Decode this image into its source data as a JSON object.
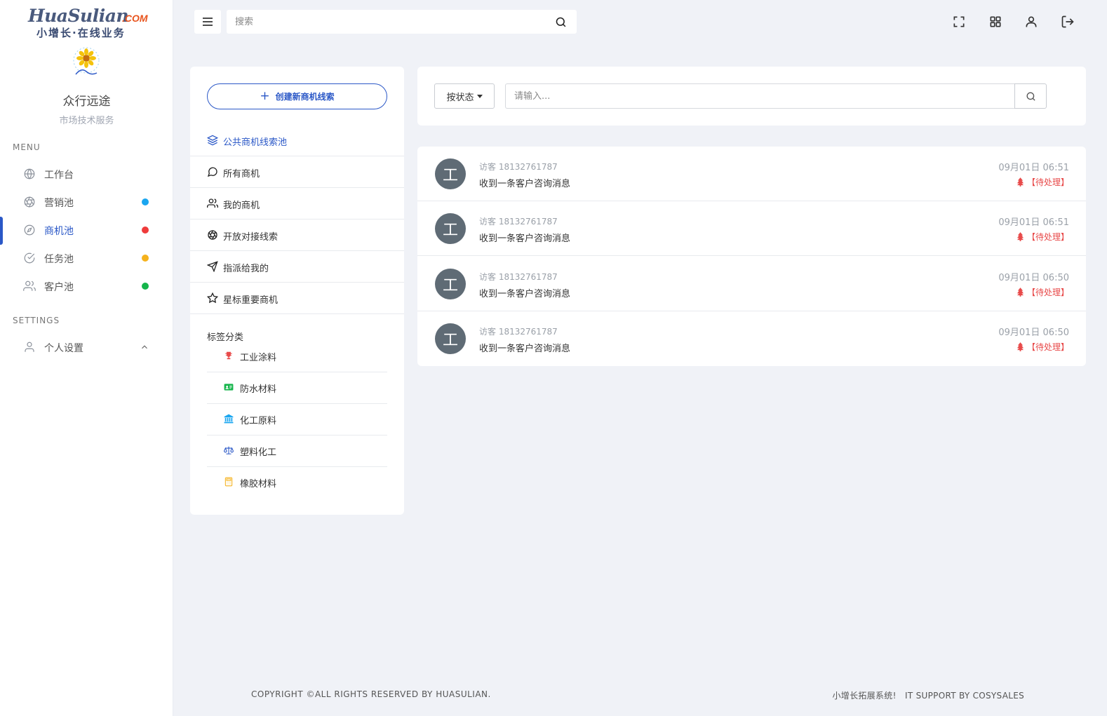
{
  "brand": {
    "logo_text": "HuaSulian",
    "logo_com": ".COM",
    "slogan": "小增长·在线业务"
  },
  "user": {
    "name": "众行远途",
    "role": "市场技术服务"
  },
  "sidebar": {
    "menu_heading": "MENU",
    "items": [
      {
        "label": "工作台",
        "icon": "globe-icon"
      },
      {
        "label": "营销池",
        "icon": "aperture-icon",
        "dot": "#1aa6f0"
      },
      {
        "label": "商机池",
        "icon": "compass-icon",
        "dot": "#ef3b3b",
        "active": true
      },
      {
        "label": "任务池",
        "icon": "check-circle-icon",
        "dot": "#f5b21d"
      },
      {
        "label": "客户池",
        "icon": "users-icon",
        "dot": "#15b54b"
      }
    ],
    "settings_heading": "SETTINGS",
    "settings_items": [
      {
        "label": "个人设置",
        "icon": "user-icon"
      }
    ]
  },
  "topbar": {
    "search_placeholder": "搜索"
  },
  "leads_panel": {
    "create_label": "创建新商机线索",
    "nav": [
      {
        "label": "公共商机线索池",
        "icon": "layers-icon",
        "active": true
      },
      {
        "label": "所有商机",
        "icon": "message-circle-icon"
      },
      {
        "label": "我的商机",
        "icon": "users-icon"
      },
      {
        "label": "开放对接线索",
        "icon": "aperture-icon"
      },
      {
        "label": "指派给我的",
        "icon": "send-icon"
      },
      {
        "label": "星标重要商机",
        "icon": "star-icon"
      }
    ],
    "tag_title": "标签分类",
    "tags": [
      {
        "label": "工业涂料",
        "icon": "trophy-icon",
        "color": "#e84a4a"
      },
      {
        "label": "防水材料",
        "icon": "id-card-icon",
        "color": "#15b54b"
      },
      {
        "label": "化工原料",
        "icon": "bank-icon",
        "color": "#1aa6f0"
      },
      {
        "label": "塑料化工",
        "icon": "balance-scale-icon",
        "color": "#2b58c7"
      },
      {
        "label": "橡胶材料",
        "icon": "calculator-icon",
        "color": "#f5b21d"
      }
    ]
  },
  "filter": {
    "status_label": "按状态",
    "input_placeholder": "请输入..."
  },
  "messages": [
    {
      "avatar": "工",
      "visitor": "访客 18132761787",
      "text": "收到一条客户咨询消息",
      "time": "09月01日 06:51",
      "status": "【待处理】"
    },
    {
      "avatar": "工",
      "visitor": "访客 18132761787",
      "text": "收到一条客户咨询消息",
      "time": "09月01日 06:51",
      "status": "【待处理】"
    },
    {
      "avatar": "工",
      "visitor": "访客 18132761787",
      "text": "收到一条客户咨询消息",
      "time": "09月01日 06:50",
      "status": "【待处理】"
    },
    {
      "avatar": "工",
      "visitor": "访客 18132761787",
      "text": "收到一条客户咨询消息",
      "time": "09月01日 06:50",
      "status": "【待处理】"
    }
  ],
  "footer": {
    "copyright": "COPYRIGHT ©ALL RIGHTS RESERVED BY HUASULIAN.",
    "support": "小增长拓展系统!   IT SUPPORT BY COSYSALES"
  },
  "colors": {
    "accent": "#2b58c7",
    "background": "#f0f2f7",
    "pending": "#e84a4a"
  }
}
